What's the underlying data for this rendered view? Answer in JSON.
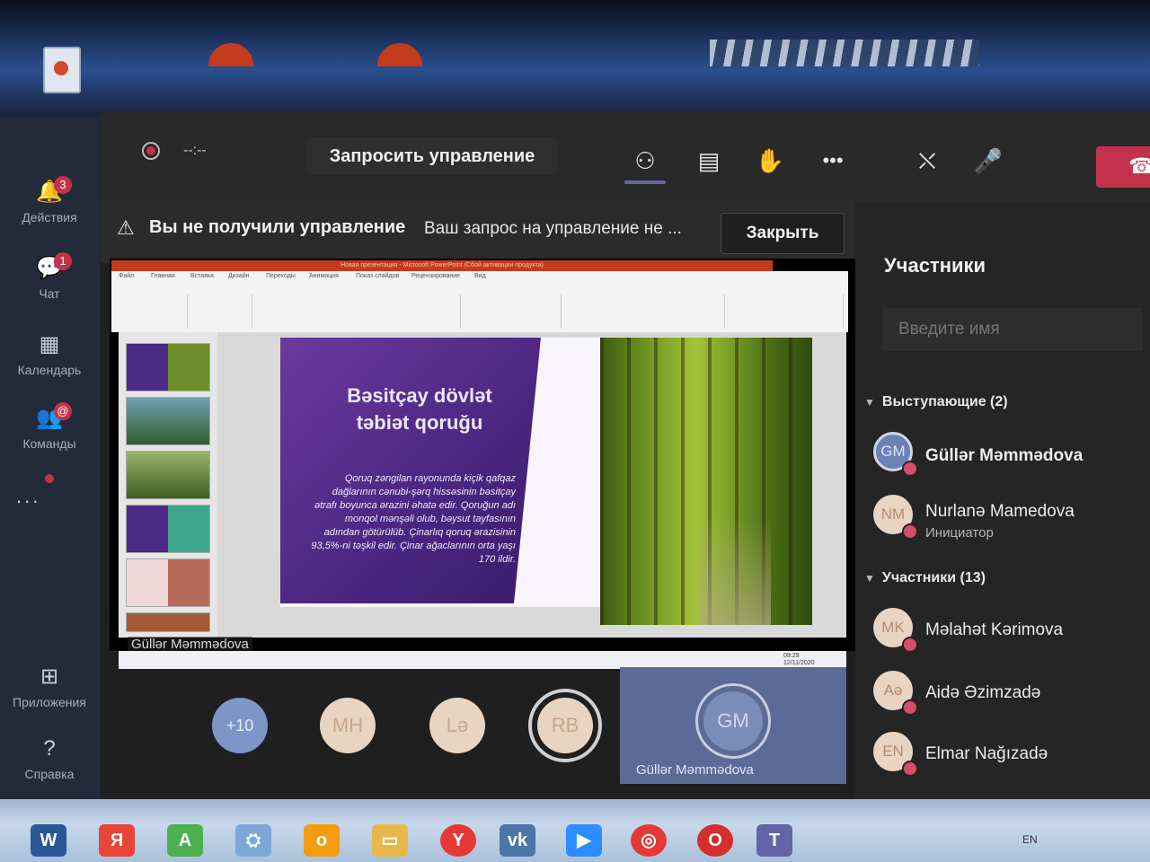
{
  "rail": {
    "items": [
      {
        "label": "Действия",
        "badge": "3"
      },
      {
        "label": "Чат",
        "badge": "1"
      },
      {
        "label": "Календарь"
      },
      {
        "label": "Команды",
        "badge": "@"
      },
      {
        "label": "Приложения"
      },
      {
        "label": "Справка"
      }
    ],
    "more": "..."
  },
  "toolbar": {
    "timer": "--:--",
    "request_control": "Запросить управление",
    "leave_icon": "phone-hangup-icon"
  },
  "notice": {
    "title": "Вы не получили управление",
    "message": "Ваш запрос на управление не ...",
    "close": "Закрыть"
  },
  "shared_screen": {
    "window_title": "Новая презентация - Microsoft PowerPoint (Сбой активации продукта)",
    "ribbon_tabs": [
      "Файл",
      "Главная",
      "Вставка",
      "Дизайн",
      "Переходы",
      "Анимация",
      "Показ слайдов",
      "Рецензирование",
      "Вид"
    ],
    "slide_title_line1": "Bəsitçay dövlət",
    "slide_title_line2": "təbiət qoruğu",
    "slide_text": "Qoruq zəngilan rayonunda kiçik qafqaz dağlarının cənubi-şərq hissəsinin bəsitçay ətrafı boyunca ərazini əhatə edir. Qoruğun adı monqol mənşəli olub, bəysut tayfasının adından götürülüb. Çinarlıq qoruq ərazisinin 93,5%-ni təşkil edir. Çinar ağaclarının orta yaşı 170 ildir.",
    "presenter_label": "Güllər Məmmədova",
    "clock_time": "09:29",
    "clock_date": "12/11/2020"
  },
  "stage_avatars": [
    "+10",
    "MH",
    "Lə",
    "RB"
  ],
  "speaker_tile": {
    "initials": "GM",
    "name": "Güllər Məmmədova"
  },
  "participants_panel": {
    "title": "Участники",
    "search_placeholder": "Введите имя",
    "presenters_header": "Выступающие (2)",
    "presenters": [
      {
        "initials": "GM",
        "name": "Güllər Məmmədova",
        "role": ""
      },
      {
        "initials": "NM",
        "name": "Nurlanə Mamedova",
        "role": "Инициатор"
      }
    ],
    "attendees_header": "Участники (13)",
    "attendees": [
      {
        "initials": "MK",
        "name": "Məlahət Kərimova"
      },
      {
        "initials": "Aə",
        "name": "Aidə Əzimzadə"
      },
      {
        "initials": "EN",
        "name": "Elmar Nağızadə"
      }
    ]
  },
  "taskbar": {
    "lang": "EN"
  },
  "colors": {
    "accent": "#6264a7",
    "leave": "#c4314b",
    "badge": "#c4314b"
  }
}
